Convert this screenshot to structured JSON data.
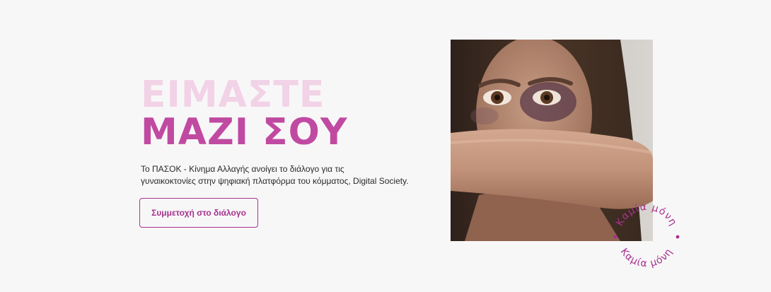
{
  "hero": {
    "headline_line1": "ΕΙΜΑΣΤΕ",
    "headline_line2": "ΜΑΖΙ ΣΟΥ",
    "description_line1": "Το ΠΑΣΟΚ - Κίνημα Αλλαγής ανοίγει το διάλογο για τις",
    "description_line2": "γυναικοκτονίες στην ψηφιακή πλατφόρμα του κόμματος, Digital Society.",
    "cta_label": "Συμμετοχή στο διάλογο",
    "stamp_text_top": "Καμία μόνη",
    "stamp_text_bottom": "Καμία μόνη"
  },
  "colors": {
    "headline_light": "#f2d2e6",
    "headline_dark": "#c04aa1",
    "accent": "#a7328e",
    "background": "#f8f7f8"
  }
}
